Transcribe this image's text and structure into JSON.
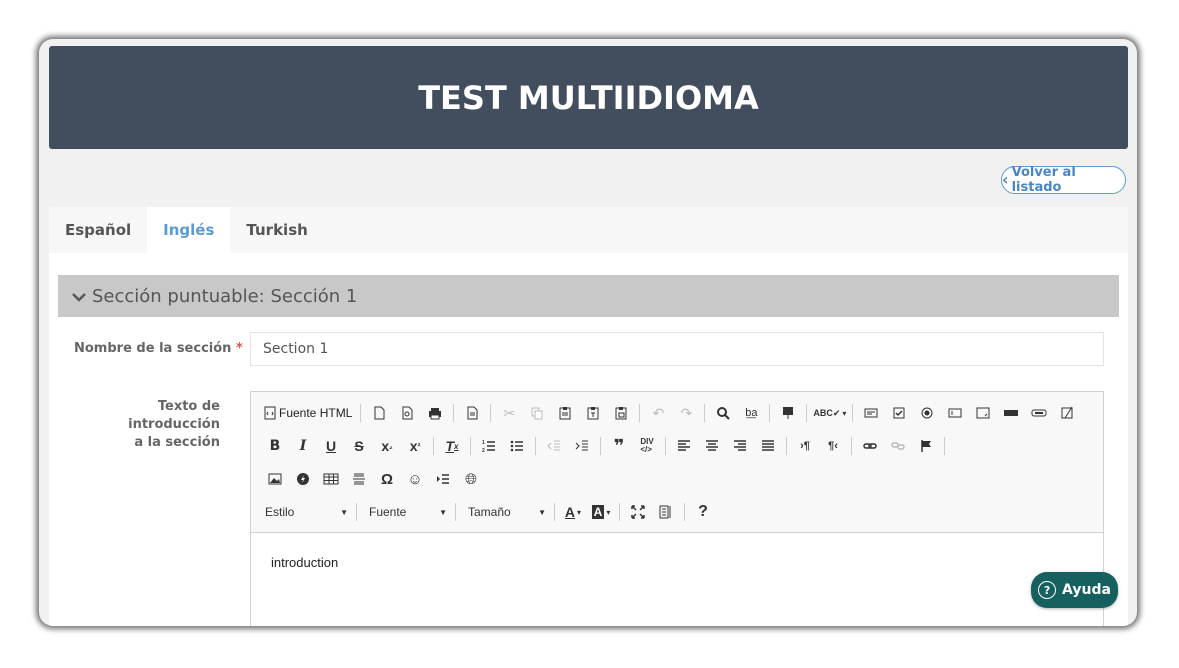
{
  "header": {
    "title": "TEST MULTIIDIOMA"
  },
  "back_button": {
    "label": "Volver al listado"
  },
  "tabs": [
    {
      "label": "Español",
      "active": false
    },
    {
      "label": "Inglés",
      "active": true
    },
    {
      "label": "Turkish",
      "active": false
    }
  ],
  "section": {
    "title": "Sección puntuable: Sección 1"
  },
  "form": {
    "name_label": "Nombre de la sección",
    "required_mark": "*",
    "name_value": "Section 1",
    "intro_label_line1": "Texto de introducción",
    "intro_label_line2": "a la sección"
  },
  "editor": {
    "source_label": "Fuente HTML",
    "style_combo": "Estilo",
    "font_combo": "Fuente",
    "size_combo": "Tamaño",
    "help_glyph": "?",
    "content": "introduction"
  },
  "help_button": {
    "label": "Ayuda"
  },
  "colors": {
    "header_bg": "#424e5e",
    "accent": "#5b9bd5",
    "help_bg": "#16615f",
    "section_bar": "#c8c8c8"
  }
}
